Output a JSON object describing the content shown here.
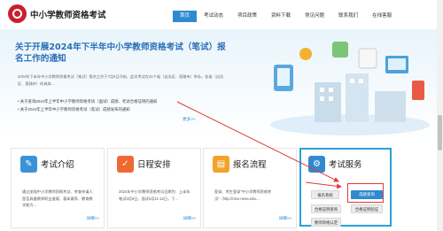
{
  "header": {
    "title": "中小学教师资格考试",
    "nav": [
      "首页",
      "考试动态",
      "项目政策",
      "资料下载",
      "常见问题",
      "联系我们",
      "在线客服"
    ]
  },
  "hero": {
    "title": "关于开展2024年下半年中小学教师资格考试（笔试）报名工作的通知",
    "desc": "2024年下半年中小学教师资格考试（笔试）报名工作于7月5日开始，此次考试在31个省（自治区、直辖市）举办。各省（自治区、直辖市）的具体…",
    "news": [
      "关于查询2024年上半年中小学教师资格考试（面试）成绩、考试合格证明的通知",
      "关于2024年上半年中小学教师资格考试（笔试）成绩发布的通知"
    ],
    "more": "更多>>"
  },
  "cards": [
    {
      "title": "考试介绍",
      "text": "通过加强中小学教师资格考试、考查申请人是否具备教师职业道德、基本素养、教育教学能力…",
      "more": "详细>>"
    },
    {
      "title": "日程安排",
      "text": "2024年中小学教师资格考试日期为：上半年笔试3月9日，面试5月11-12日，下…",
      "more": "详细>>"
    },
    {
      "title": "报名流程",
      "text": "登录、考生登录“中小学教师资格考试”（http://ntce.neea.edu…",
      "more": "详细>>"
    }
  ],
  "service": {
    "title": "考试服务",
    "buttons": [
      "报名系统",
      "成绩查询",
      "合格证明查询",
      "合格证明验证",
      "教师资格认定"
    ]
  }
}
